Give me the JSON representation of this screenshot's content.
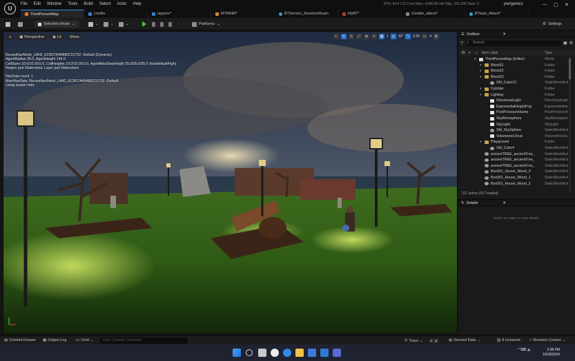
{
  "menu": [
    "File",
    "Edit",
    "Window",
    "Tools",
    "Build",
    "Select",
    "Actor",
    "Help"
  ],
  "project_name": "pwrgame1",
  "perf_stats": "FPS: 44.9  |  22.3 ms  Mem: 4,660.66 mb  Objs: 100,186  Stats: 6",
  "window_controls": {
    "minimize": "—",
    "maximize": "▢",
    "close": "✕"
  },
  "tabs": [
    {
      "label": "ThirdPersonMap",
      "color": "#e07a2a"
    },
    {
      "label": "credits",
      "color": "#3a7fd6"
    },
    {
      "label": "uigame*",
      "color": "#3a7fd6"
    },
    {
      "label": "MYANIM*",
      "color": "#d48a2e"
    },
    {
      "label": "BTService_RandomRoam",
      "color": "#3aa0e0"
    },
    {
      "label": "MyBT*",
      "color": "#c0392b"
    },
    {
      "label": "Zombie_attack*",
      "color": "#8a8a8a"
    },
    {
      "label": "BTtask_Attack*",
      "color": "#3aa0e0"
    }
  ],
  "toolbar": {
    "selection_mode": "Selection Mode",
    "platforms": "Platforms",
    "settings": "Settings"
  },
  "viewport": {
    "perspective": "Perspective",
    "lit": "Lit",
    "show": "Show",
    "grid_value": "10°",
    "scale_value": "0.25",
    "camera_speed": "4",
    "info_lines": [
      "RecastNavMesh_UAID_ECB07A49A80C01702 -Default (Dynamic)",
      "AgentRadius 35.0, AgentHeight 144.0",
      "CellSizes 10.0/10.0/10.0, CellHeights 10.0/10.0/10.0, AgentMaxStepHeight 35.0/35.0/35.0 (low/default/high)",
      "Region part Watershed, Layer part Watershed",
      "",
      "NavData count: 1",
      "MainNavData: RecastNavMesh_UAID_ECB07A49A80C01702 -Default",
      "Using cluster links"
    ]
  },
  "outliner": {
    "title": "Outliner",
    "search_placeholder": "Search",
    "col_label": "Item Label",
    "col_type": "Type",
    "actors_count": "317 actors (317 loaded)",
    "rows": [
      {
        "label": "ThirdPersonMap (Editor)",
        "type": "World",
        "indent": 0,
        "icon": "world"
      },
      {
        "label": "Block01",
        "type": "Folder",
        "indent": 1,
        "icon": "folder"
      },
      {
        "label": "Block02",
        "type": "Folder",
        "indent": 1,
        "icon": "folder"
      },
      {
        "label": "Block03",
        "type": "Folder",
        "indent": 1,
        "icon": "folder"
      },
      {
        "label": "SM_Cube13",
        "type": "StaticMeshActor",
        "indent": 2,
        "icon": "mesh"
      },
      {
        "label": "Cylinder",
        "type": "Folder",
        "indent": 1,
        "icon": "folder"
      },
      {
        "label": "Lighting",
        "type": "Folder",
        "indent": 1,
        "icon": "folder"
      },
      {
        "label": "DirectionalLight",
        "type": "DirectionalLight",
        "indent": 2,
        "icon": "light"
      },
      {
        "label": "ExponentialHeightFog",
        "type": "ExponentialHeightFog",
        "indent": 2,
        "icon": "light"
      },
      {
        "label": "PostProcessVolume",
        "type": "PostProcessVolume",
        "indent": 2,
        "icon": "light"
      },
      {
        "label": "SkyAtmosphere",
        "type": "SkyAtmosphere",
        "indent": 2,
        "icon": "light"
      },
      {
        "label": "SkyLight",
        "type": "SkyLight",
        "indent": 2,
        "icon": "light"
      },
      {
        "label": "SM_SkySphere",
        "type": "StaticMeshActor",
        "indent": 2,
        "icon": "mesh"
      },
      {
        "label": "VolumetricCloud",
        "type": "VolumetricCloud",
        "indent": 2,
        "icon": "light"
      },
      {
        "label": "Playground",
        "type": "Folder",
        "indent": 1,
        "icon": "folder"
      },
      {
        "label": "SM_Cube4",
        "type": "StaticMeshActor",
        "indent": 2,
        "icon": "mesh"
      },
      {
        "label": "ancientTREE_ancientTree_",
        "type": "StaticMeshActor",
        "indent": 1,
        "icon": "mesh"
      },
      {
        "label": "ancientTREE_ancientTree_",
        "type": "StaticMeshActor",
        "indent": 1,
        "icon": "mesh"
      },
      {
        "label": "ancientTREE_ancientTree_",
        "type": "StaticMeshActor",
        "indent": 1,
        "icon": "mesh"
      },
      {
        "label": "Box001_House_Wood_0",
        "type": "StaticMeshActor",
        "indent": 1,
        "icon": "mesh"
      },
      {
        "label": "Box001_House_Wood_1",
        "type": "StaticMeshActor",
        "indent": 1,
        "icon": "mesh"
      },
      {
        "label": "Box001_House_Wood_2",
        "type": "StaticMeshActor",
        "indent": 1,
        "icon": "mesh"
      }
    ]
  },
  "details": {
    "title": "Details",
    "empty_text": "Select an object to view details."
  },
  "statusbar": {
    "content_drawer": "Content Drawer",
    "output_log": "Output Log",
    "cmd": "Cmd",
    "console_placeholder": "Enter Console Command",
    "trace": "Trace",
    "derived_data": "Derived Data",
    "unsaved": "8 Unsaved",
    "revision_control": "Revision Control"
  },
  "taskbar": {
    "tray_text": "^  ⌨  🔈",
    "time": "2:08 PM",
    "date": "10/29/2024"
  }
}
